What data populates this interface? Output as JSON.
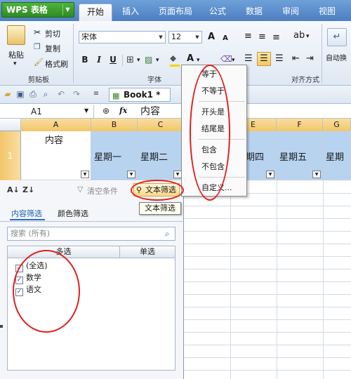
{
  "app": {
    "name": "WPS 表格"
  },
  "menu_tabs": [
    "开始",
    "插入",
    "页面布局",
    "公式",
    "数据",
    "审阅",
    "视图"
  ],
  "ribbon": {
    "paste_label": "粘贴",
    "cut_label": "剪切",
    "copy_label": "复制",
    "format_painter_label": "格式刷",
    "clipboard_group": "剪贴板",
    "font_name": "宋体",
    "font_size": "12",
    "grow_font": "A",
    "shrink_font": "A",
    "bold": "B",
    "italic": "I",
    "underline": "U",
    "font_group": "字体",
    "align_group": "对齐方式",
    "auto_wrap": "自动换",
    "highlight_color": "#f5d400",
    "font_color": "#e02020"
  },
  "quick_access": {
    "workbook_tab": "Book1 *"
  },
  "formula_bar": {
    "name_box": "A1",
    "fx_label": "fx",
    "value": "内容"
  },
  "grid": {
    "columns": [
      "A",
      "B",
      "C",
      "D",
      "E",
      "F",
      "G"
    ],
    "row_label": "1",
    "cells": [
      "内容",
      "星期一",
      "星期二",
      "",
      "期四",
      "星期五",
      "星期"
    ]
  },
  "filter_panel": {
    "sort_asc": "A↓",
    "sort_desc": "Z↓",
    "clear_condition": "清空条件",
    "text_filter_button": "文本筛选",
    "tooltip": "文本筛选",
    "tab_content": "内容筛选",
    "tab_color": "颜色筛选",
    "search_placeholder": "搜索 (所有)",
    "col_multi": "多选",
    "col_single": "单选",
    "items": [
      {
        "label": "(全选)",
        "checked": true
      },
      {
        "label": "数学",
        "checked": true
      },
      {
        "label": "语文",
        "checked": true
      }
    ]
  },
  "text_filter_menu": [
    "等于",
    "不等于",
    "开头是",
    "结尾是",
    "包含",
    "不包含",
    "自定义..."
  ]
}
